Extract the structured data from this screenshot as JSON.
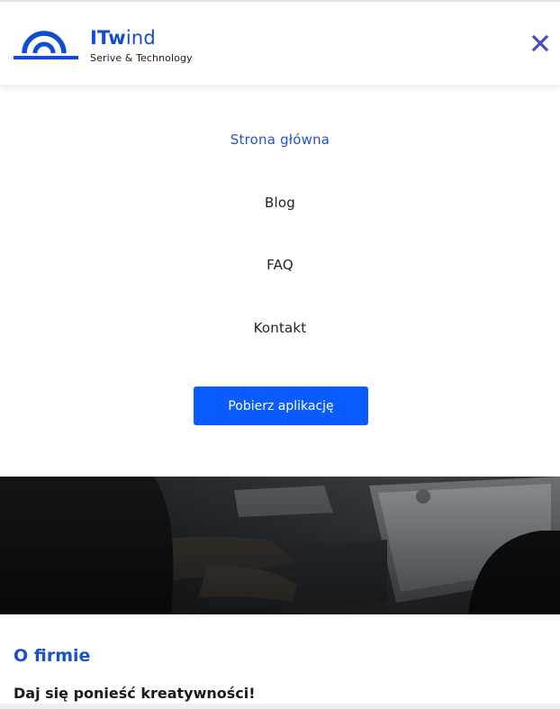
{
  "header": {
    "brand_bold": "ITw",
    "brand_light": "ind",
    "tagline": "Serive & Technology",
    "accent_color": "#0f4fcf",
    "close_icon": "close-icon"
  },
  "menu": {
    "items": [
      {
        "label": "Strona główna",
        "active": true
      },
      {
        "label": "Blog",
        "active": false
      },
      {
        "label": "FAQ",
        "active": false
      },
      {
        "label": "Kontakt",
        "active": false
      }
    ],
    "cta_label": "Pobierz aplikację",
    "cta_color": "#0a5cff"
  },
  "about": {
    "title": "O firmie",
    "subtitle": "Daj się ponieść kreatywności!"
  }
}
